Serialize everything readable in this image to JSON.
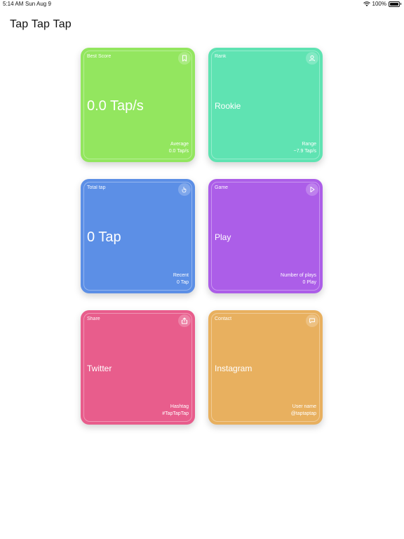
{
  "status": {
    "time": "5:14 AM",
    "date": "Sun Aug 9",
    "battery": "100%"
  },
  "header": {
    "title": "Tap Tap Tap"
  },
  "cards": [
    {
      "label": "Best Score",
      "value": "0.0 Tap/s",
      "meta_label": "Average",
      "meta_value": "0.0 Tap/s",
      "icon": "bookmark-icon",
      "color": "#93e65f"
    },
    {
      "label": "Rank",
      "value": "Rookie",
      "meta_label": "Range",
      "meta_value": "~7.9 Tap/s",
      "icon": "person-icon",
      "color": "#5fe3b2"
    },
    {
      "label": "Total tap",
      "value": "0 Tap",
      "meta_label": "Recent",
      "meta_value": "0 Tap",
      "icon": "hand-pointer-icon",
      "color": "#5c8fe6"
    },
    {
      "label": "Game",
      "value": "Play",
      "meta_label": "Number of plays",
      "meta_value": "0 Play",
      "icon": "play-icon",
      "color": "#ac5ee8"
    },
    {
      "label": "Share",
      "value": "Twitter",
      "meta_label": "Hashtag",
      "meta_value": "#TapTapTap",
      "icon": "share-icon",
      "color": "#e85d8c"
    },
    {
      "label": "Contact",
      "value": "Instagram",
      "meta_label": "User name",
      "meta_value": "@taptaptap",
      "icon": "message-icon",
      "color": "#e8b05f"
    }
  ]
}
